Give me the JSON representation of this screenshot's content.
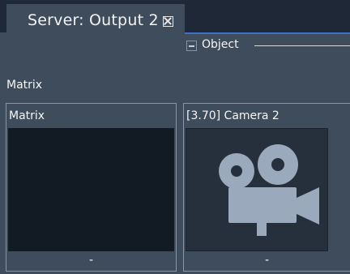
{
  "tab": {
    "title": "Server: Output 2"
  },
  "object_header": {
    "label": "Object"
  },
  "section": {
    "label": "Matrix"
  },
  "cards": [
    {
      "title": "Matrix",
      "footer": "-"
    },
    {
      "title": "[3.70] Camera 2",
      "footer": "-"
    }
  ],
  "icons": {
    "tab_close": "close-box-icon",
    "collapse": "collapse-minus-icon",
    "camera": "video-camera-icon"
  }
}
